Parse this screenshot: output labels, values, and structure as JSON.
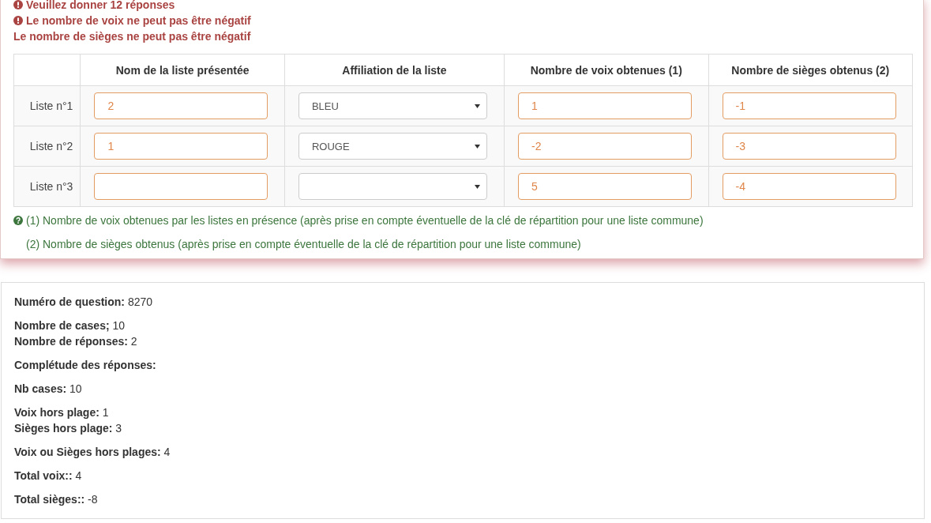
{
  "errors": [
    {
      "text": "Veuillez donner 12 réponses",
      "icon": true
    },
    {
      "text": "Le nombre de voix ne peut pas être négatif",
      "icon": true
    },
    {
      "text": "Le nombre de sièges ne peut pas être négatif",
      "icon": false
    }
  ],
  "table": {
    "columns": [
      "Nom de la liste présentée",
      "Affiliation de la liste",
      "Nombre de voix obtenues (1)",
      "Nombre de sièges obtenus (2)"
    ],
    "rows": [
      {
        "label": "Liste n°1",
        "name": "2",
        "affiliation": "BLEU",
        "votes": "1",
        "seats": "-1"
      },
      {
        "label": "Liste n°2",
        "name": "1",
        "affiliation": "ROUGE",
        "votes": "-2",
        "seats": "-3"
      },
      {
        "label": "Liste n°3",
        "votes": "5",
        "seats": "-4"
      }
    ]
  },
  "footnotes": [
    {
      "text": "(1) Nombre de voix obtenues par les listes en présence (après prise en compte éventuelle de la clé de répartition pour une liste commune)",
      "icon": true
    },
    {
      "text": "(2) Nombre de sièges obtenus (après prise en compte éventuelle de la clé de répartition pour une liste commune)",
      "icon": false
    }
  ],
  "info_groups": [
    [
      {
        "label": "Numéro de question:",
        "value": "8270"
      }
    ],
    [
      {
        "label": "Nombre de cases;",
        "value": "10"
      },
      {
        "label": "Nombre de réponses:",
        "value": "2"
      }
    ],
    [
      {
        "label": "Complétude des réponses:"
      }
    ],
    [
      {
        "label": "Nb cases:",
        "value": "10"
      }
    ],
    [
      {
        "label": "Voix hors plage:",
        "value": "1"
      },
      {
        "label": "Sièges hors plage:",
        "value": "3"
      }
    ],
    [
      {
        "label": "Voix ou Sièges hors plages:",
        "value": "4"
      }
    ],
    [
      {
        "label": "Total voix::",
        "value": "4"
      }
    ],
    [
      {
        "label": "Total sièges::",
        "value": "-8"
      }
    ]
  ]
}
